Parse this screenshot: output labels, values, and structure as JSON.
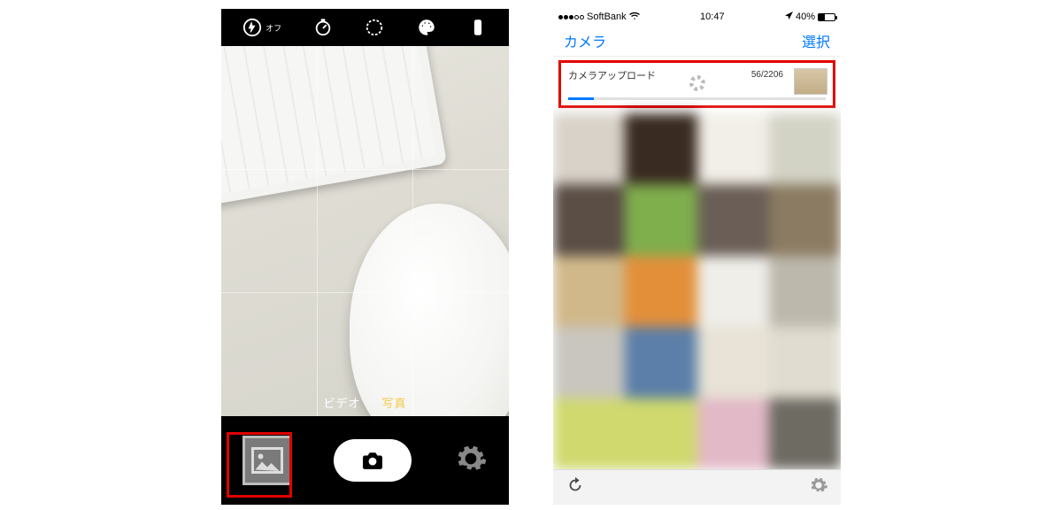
{
  "left": {
    "flash_label": "オフ",
    "modes": {
      "video": "ビデオ",
      "photo": "写真",
      "active": "photo"
    }
  },
  "right": {
    "status": {
      "carrier": "SoftBank",
      "time": "10:47",
      "battery_pct": "40%"
    },
    "nav": {
      "back": "カメラ",
      "select": "選択"
    },
    "upload": {
      "title": "カメラアップロード",
      "done": 56,
      "total": 2206,
      "count_text": "56/2206",
      "progress_pct": 10
    }
  }
}
